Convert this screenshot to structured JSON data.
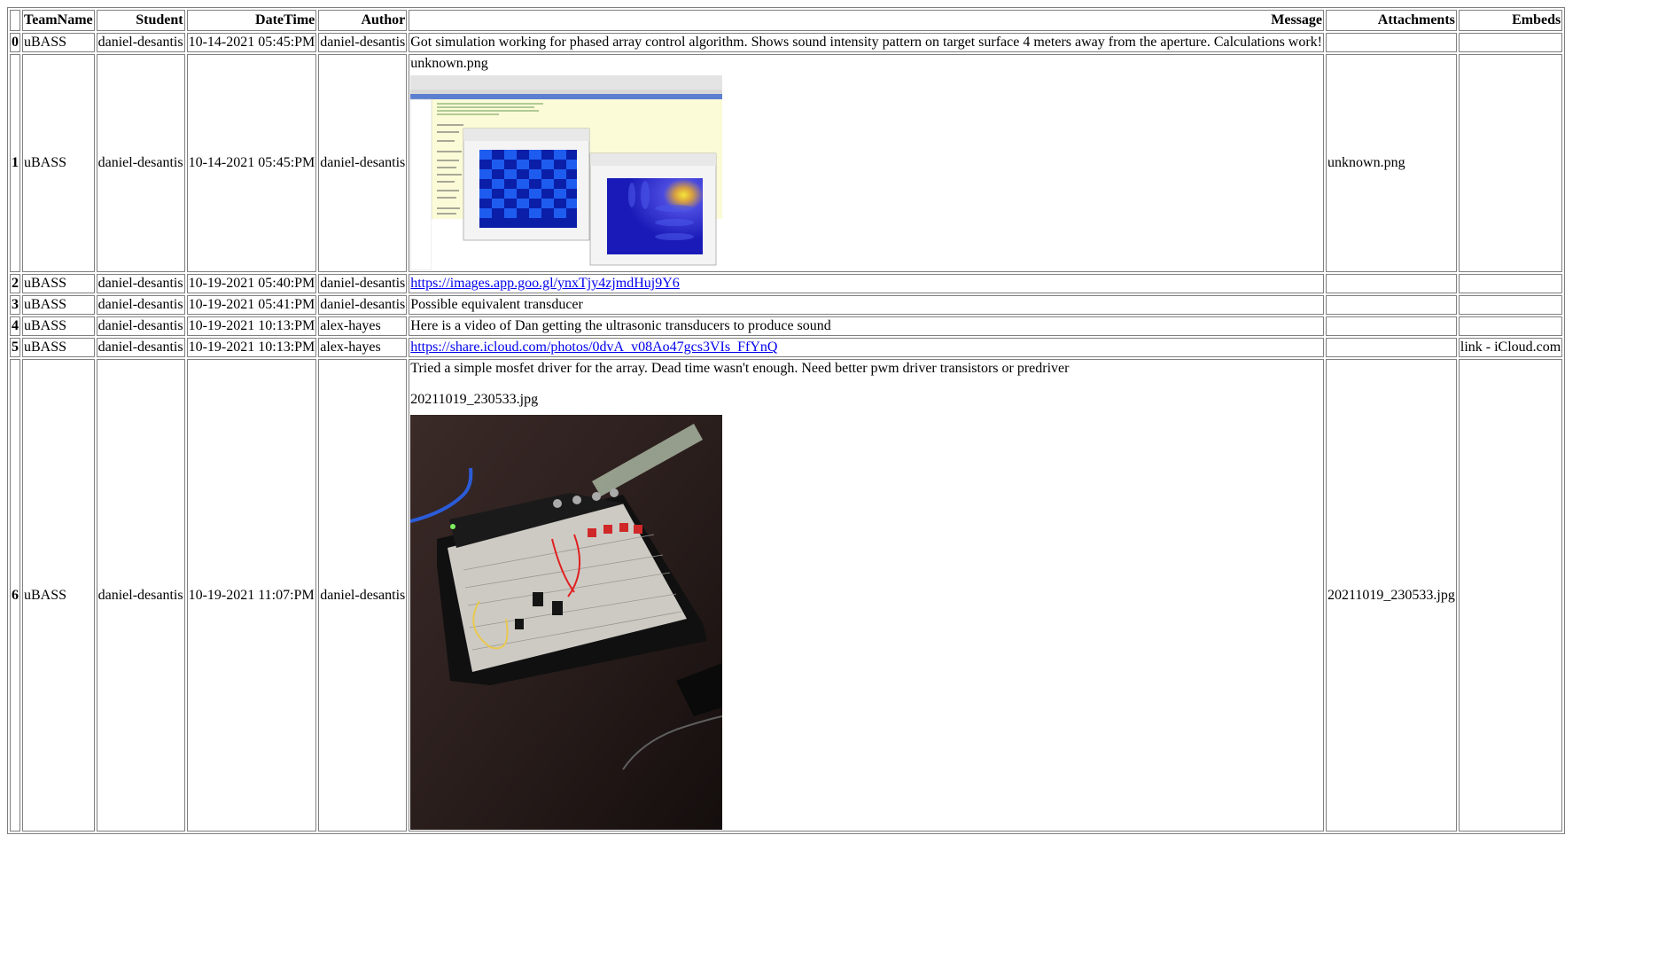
{
  "columns": [
    "",
    "TeamName",
    "Student",
    "DateTime",
    "Author",
    "Message",
    "Attachments",
    "Embeds"
  ],
  "rows": [
    {
      "idx": "0",
      "team": "uBASS",
      "student": "daniel-desantis",
      "datetime": "10-14-2021 05:45:PM",
      "author": "daniel-desantis",
      "message": "Got simulation working for phased array control algorithm. Shows sound intensity pattern on target surface 4 meters away from the aperture. Calculations work!",
      "attachments": "",
      "embeds": ""
    },
    {
      "idx": "1",
      "team": "uBASS",
      "student": "daniel-desantis",
      "datetime": "10-14-2021 05:45:PM",
      "author": "daniel-desantis",
      "message_file": "unknown.png",
      "image_desc": "matlab-simulation-screenshot",
      "attachments": "unknown.png",
      "embeds": ""
    },
    {
      "idx": "2",
      "team": "uBASS",
      "student": "daniel-desantis",
      "datetime": "10-19-2021 05:40:PM",
      "author": "daniel-desantis",
      "link": "https://images.app.goo.gl/ynxTjy4zjmdHuj9Y6",
      "attachments": "",
      "embeds": ""
    },
    {
      "idx": "3",
      "team": "uBASS",
      "student": "daniel-desantis",
      "datetime": "10-19-2021 05:41:PM",
      "author": "daniel-desantis",
      "message": "Possible equivalent transducer",
      "attachments": "",
      "embeds": ""
    },
    {
      "idx": "4",
      "team": "uBASS",
      "student": "daniel-desantis",
      "datetime": "10-19-2021 10:13:PM",
      "author": "alex-hayes",
      "message": "Here is a video of Dan getting the ultrasonic transducers to produce sound",
      "attachments": "",
      "embeds": ""
    },
    {
      "idx": "5",
      "team": "uBASS",
      "student": "daniel-desantis",
      "datetime": "10-19-2021 10:13:PM",
      "author": "alex-hayes",
      "link": "https://share.icloud.com/photos/0dvA_v08Ao47gcs3VIs_FfYnQ",
      "attachments": "",
      "embeds": "link - iCloud.com"
    },
    {
      "idx": "6",
      "team": "uBASS",
      "student": "daniel-desantis",
      "datetime": "10-19-2021 11:07:PM",
      "author": "daniel-desantis",
      "message": "Tried a simple mosfet driver for the array. Dead time wasn't enough. Need better pwm driver transistors or predriver",
      "message_file": "20211019_230533.jpg",
      "image_desc": "breadboard-photo",
      "attachments": "20211019_230533.jpg",
      "embeds": ""
    }
  ]
}
